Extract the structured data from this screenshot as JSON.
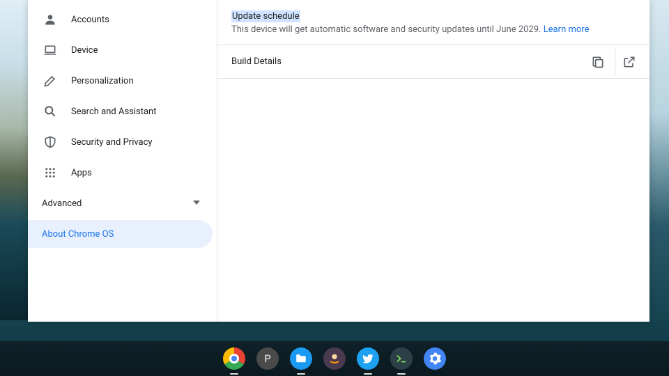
{
  "sidebar": {
    "items": [
      {
        "label": "Accounts",
        "icon": "person-icon"
      },
      {
        "label": "Device",
        "icon": "laptop-icon"
      },
      {
        "label": "Personalization",
        "icon": "palette-icon"
      },
      {
        "label": "Search and Assistant",
        "icon": "search-icon"
      },
      {
        "label": "Security and Privacy",
        "icon": "shield-icon"
      },
      {
        "label": "Apps",
        "icon": "apps-icon"
      }
    ],
    "advanced_label": "Advanced",
    "about_label": "About Chrome OS"
  },
  "main": {
    "update_schedule": {
      "heading": "Update schedule",
      "description": "This device will get automatic software and security updates until June 2029.",
      "learn_more": "Learn more"
    },
    "build_details": {
      "title": "Build Details"
    }
  },
  "shelf": {
    "apps": [
      {
        "name": "chrome-app",
        "indicator": true
      },
      {
        "name": "text-app",
        "letter": "P",
        "indicator": false
      },
      {
        "name": "files-app",
        "indicator": true
      },
      {
        "name": "amazon-app",
        "indicator": false
      },
      {
        "name": "twitter-app",
        "indicator": true
      },
      {
        "name": "terminal-app",
        "indicator": true
      },
      {
        "name": "settings-app",
        "indicator": false
      }
    ]
  }
}
